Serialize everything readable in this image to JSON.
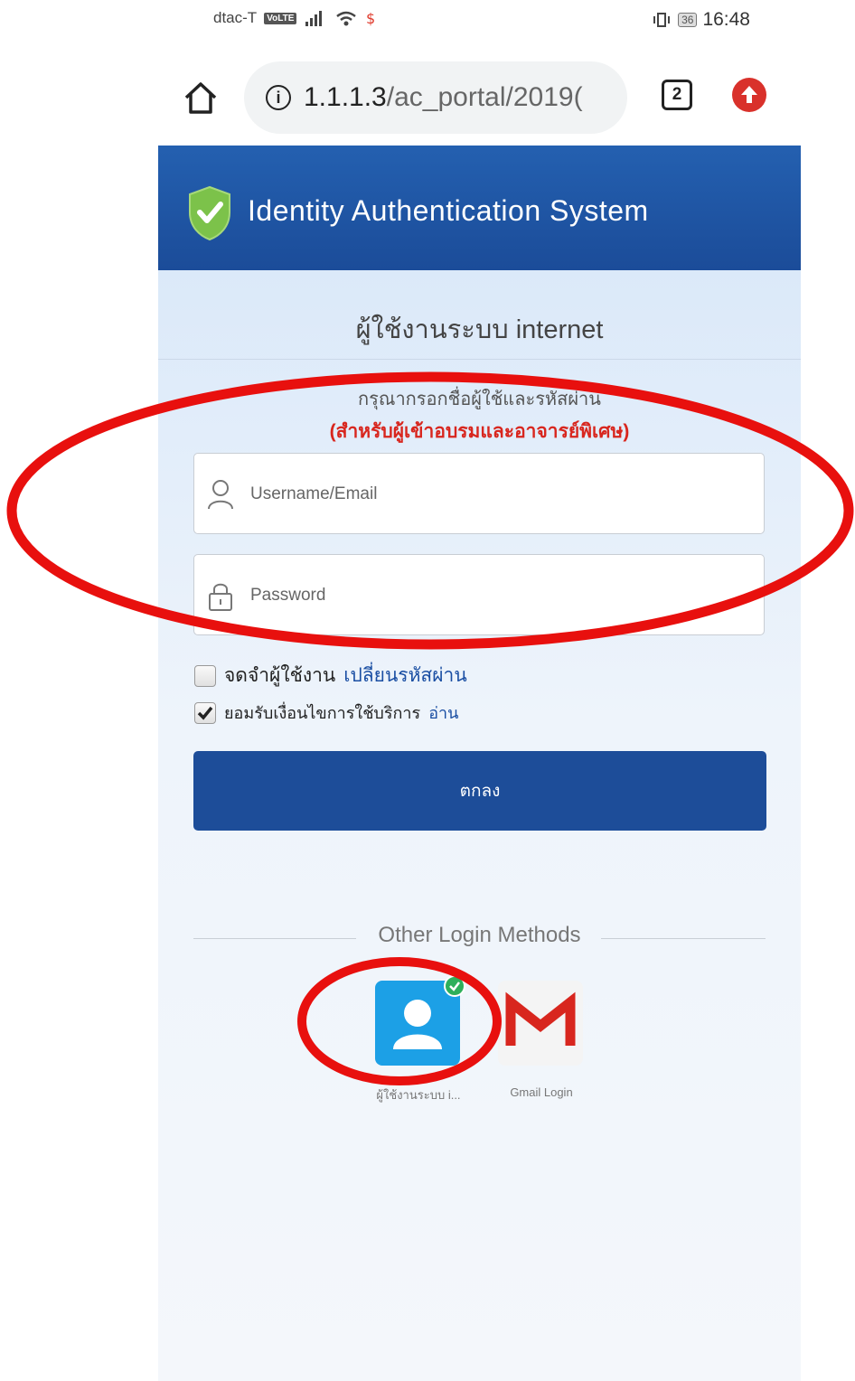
{
  "status_bar": {
    "carrier": "dtac-T",
    "volte": "VoLTE",
    "battery": "36",
    "time": "16:48"
  },
  "browser": {
    "url_host": "1.1.1.3",
    "url_path": "/ac_portal/2019(",
    "tab_count": "2"
  },
  "header": {
    "title": "Identity Authentication System"
  },
  "login": {
    "page_title": "ผู้ใช้งานระบบ internet",
    "instruction": "กรุณากรอกชื่อผู้ใช้และรหัสผ่าน",
    "instruction_highlight": "(สำหรับผู้เข้าอบรมและอาจารย์พิเศษ)",
    "username_placeholder": "Username/Email",
    "password_placeholder": "Password",
    "remember_label": "จดจำผู้ใช้งาน",
    "change_password_link": "เปลี่ยนรหัสผ่าน",
    "accept_terms_label": "ยอมรับเงื่อนไขการใช้บริการ",
    "read_terms_link": "อ่าน",
    "remember_checked": false,
    "accept_terms_checked": true,
    "submit_label": "ตกลง"
  },
  "other_login": {
    "title": "Other Login Methods",
    "methods": [
      {
        "label": "ผู้ใช้งานระบบ i...",
        "icon": "user-icon",
        "color": "#1ca0e6",
        "selected": true
      },
      {
        "label": "Gmail Login",
        "icon": "gmail-icon",
        "color": "#d8261e",
        "selected": false
      }
    ]
  },
  "colors": {
    "header_bg": "#1f58a8",
    "button_bg": "#1d4d99",
    "annotation": "#e8100e"
  }
}
